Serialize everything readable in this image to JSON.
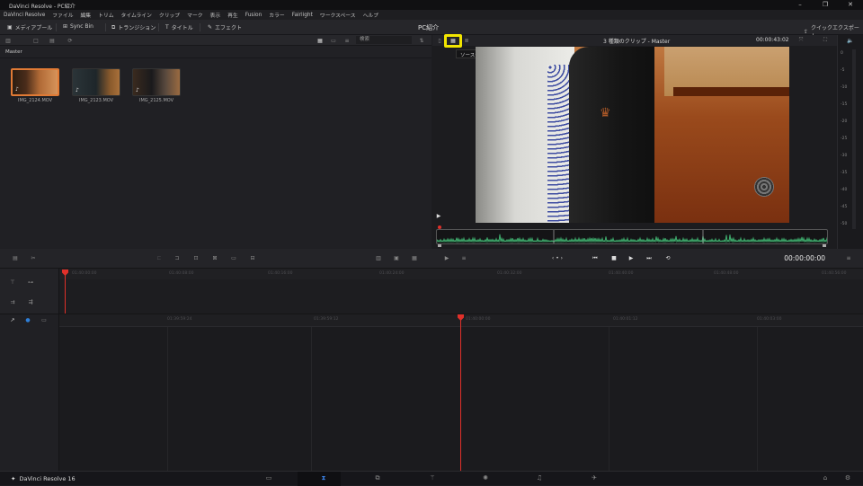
{
  "window": {
    "title": "DaVinci Resolve - PC紹介"
  },
  "menu": [
    "DaVinci Resolve",
    "ファイル",
    "編集",
    "トリム",
    "タイムライン",
    "クリップ",
    "マーク",
    "表示",
    "再生",
    "Fusion",
    "カラー",
    "Fairlight",
    "ワークスペース",
    "ヘルプ"
  ],
  "toolbar": {
    "media_pool": "メディアプール",
    "sync_bin": "Sync Bin",
    "transitions": "トランジション",
    "titles": "タイトル",
    "effects": "エフェクト",
    "project_name": "PC紹介",
    "quick_export": "クイックエクスポート"
  },
  "media": {
    "search_label": "検索",
    "bin_name": "Master",
    "clips": [
      {
        "name": "IMG_2124.MOV",
        "selected": true
      },
      {
        "name": "IMG_2123.MOV",
        "selected": false
      },
      {
        "name": "IMG_2125.MOV",
        "selected": false
      }
    ]
  },
  "viewer": {
    "title": "3 種類のクリップ - Master",
    "timecode": "00:00:43:02",
    "tooltip": "ソーステープ",
    "playhead_timecode": "00:00:00:00"
  },
  "meters": {
    "scale": [
      "0",
      "-5",
      "-10",
      "-15",
      "-20",
      "-25",
      "-30",
      "-35",
      "-40",
      "-45",
      "-50"
    ]
  },
  "timeline": {
    "upper_ruler": [
      "01:40:00:00",
      "01:40:08:00",
      "01:40:16:00",
      "01:40:24:00",
      "01:40:32:00",
      "01:40:40:00",
      "01:40:48:00",
      "01:40:56:00"
    ],
    "lower_ruler": [
      "01:39:59:24",
      "01:39:59:12",
      "01:40:00:00",
      "01:40:01:12",
      "01:40:03:00"
    ]
  },
  "footer": {
    "app": "DaVinci Resolve 16"
  },
  "colors": {
    "accent": "#e07a35",
    "highlight": "#f2e500",
    "playhead": "#e0302a",
    "waveform": "#3fae6e"
  }
}
